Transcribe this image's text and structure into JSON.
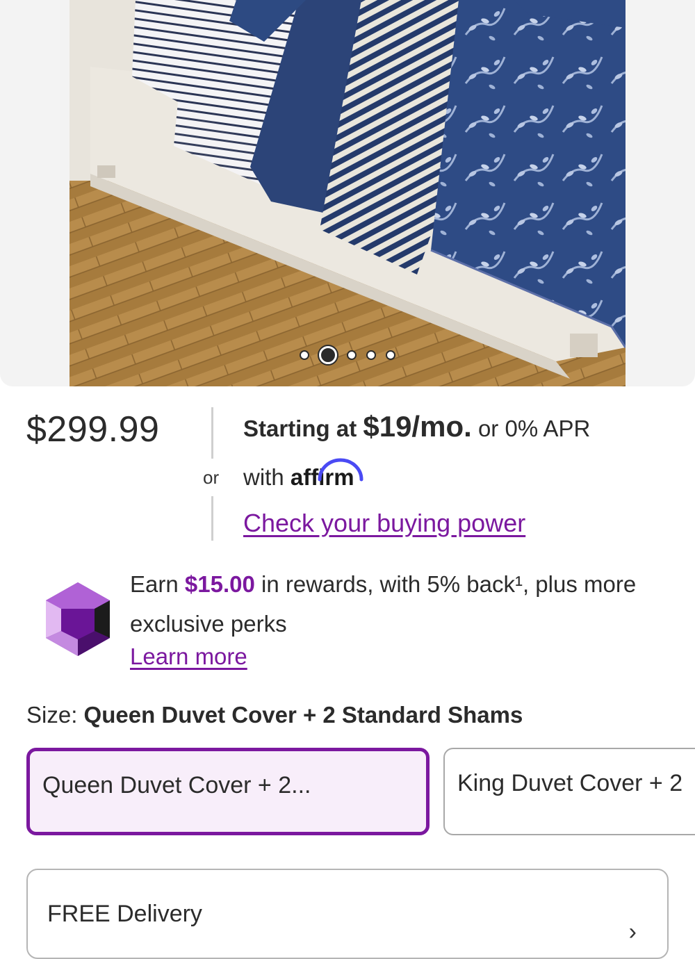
{
  "gallery": {
    "image_alt": "Navy floral and striped bedding on a white bed frame over herringbone wood floor",
    "dots_count": 5,
    "active_index": 1
  },
  "price": {
    "amount": "$299.99",
    "separator": "or"
  },
  "affirm": {
    "starting_text": "Starting at",
    "monthly": "$19/mo.",
    "apr_text": "or 0% APR",
    "with_text": "with",
    "logo_text": "affirm",
    "buying_power_link": "Check your buying power"
  },
  "rewards": {
    "earn_prefix": "Earn",
    "amount": "$15.00",
    "line_rest": "in rewards, with 5% back¹, plus more exclusive perks",
    "learn_more": "Learn more",
    "icon": "purple-gem-icon"
  },
  "size": {
    "label": "Size:",
    "selected_value": "Queen Duvet Cover + 2 Standard Shams",
    "options": [
      {
        "label": "Queen Duvet Cover + 2...",
        "selected": true
      },
      {
        "label": "King Duvet Cover + 2",
        "selected": false
      }
    ]
  },
  "delivery": {
    "label": "FREE Delivery",
    "chevron": "chevron-right-icon"
  },
  "colors": {
    "accent": "#7b189f",
    "selected_bg": "#f8eefa",
    "gallery_bg": "#f3f3f3"
  }
}
